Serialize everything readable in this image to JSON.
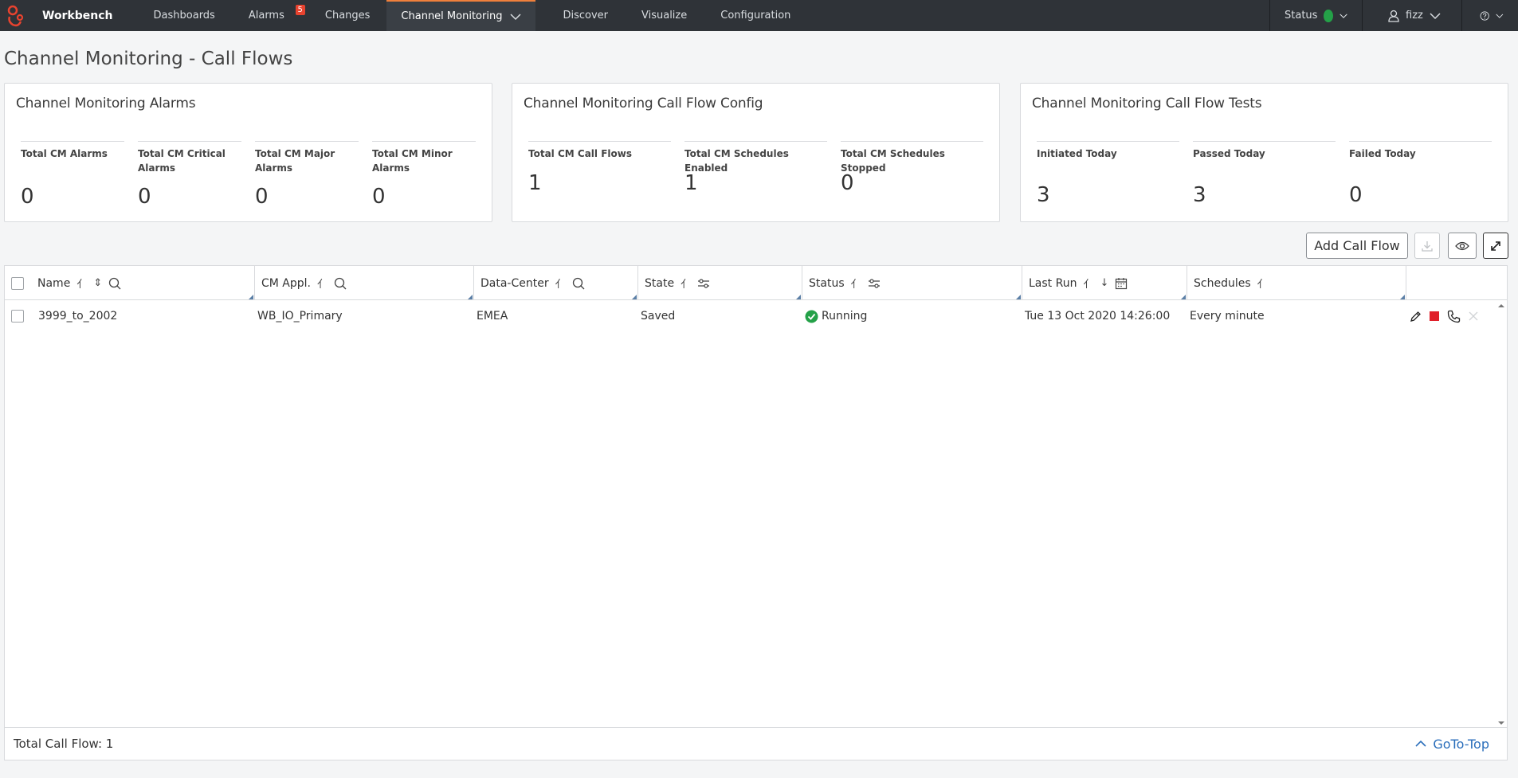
{
  "nav": {
    "brand": "Workbench",
    "items": [
      {
        "label": "Dashboards"
      },
      {
        "label": "Alarms",
        "badge": "5"
      },
      {
        "label": "Changes"
      },
      {
        "label": "Channel Monitoring"
      },
      {
        "label": "Discover"
      },
      {
        "label": "Visualize"
      },
      {
        "label": "Configuration"
      }
    ],
    "status_label": "Status",
    "user": "fizz"
  },
  "page": {
    "title": "Channel Monitoring - Call Flows"
  },
  "cards": [
    {
      "title": "Channel Monitoring Alarms",
      "metrics": [
        {
          "label": "Total CM Alarms",
          "value": "0"
        },
        {
          "label": "Total CM Critical Alarms",
          "value": "0"
        },
        {
          "label": "Total CM Major Alarms",
          "value": "0"
        },
        {
          "label": "Total CM Minor Alarms",
          "value": "0"
        }
      ]
    },
    {
      "title": "Channel Monitoring Call Flow Config",
      "metrics": [
        {
          "label": "Total CM Call Flows",
          "value": "1"
        },
        {
          "label": "Total CM Schedules Enabled",
          "value": "1"
        },
        {
          "label": "Total CM Schedules Stopped",
          "value": "0"
        }
      ]
    },
    {
      "title": "Channel Monitoring Call Flow Tests",
      "metrics": [
        {
          "label": "Initiated Today",
          "value": "3"
        },
        {
          "label": "Passed Today",
          "value": "3"
        },
        {
          "label": "Failed Today",
          "value": "0"
        }
      ]
    }
  ],
  "toolbar": {
    "add_label": "Add Call Flow"
  },
  "table": {
    "columns": [
      "Name",
      "CM Appl.",
      "Data-Center",
      "State",
      "Status",
      "Last Run",
      "Schedules"
    ],
    "rows": [
      {
        "name": "3999_to_2002",
        "app": "WB_IO_Primary",
        "dc": "EMEA",
        "state": "Saved",
        "status": "Running",
        "last_run": "Tue 13 Oct 2020 14:26:00",
        "schedules": "Every minute"
      }
    ],
    "footer_total": "Total Call Flow: 1",
    "goto_top": "GoTo-Top"
  },
  "colors": {
    "nav_bg": "#2f3338",
    "accent": "#f0803c",
    "running": "#24a148",
    "link": "#2a6ebb",
    "stop": "#e0202a"
  }
}
